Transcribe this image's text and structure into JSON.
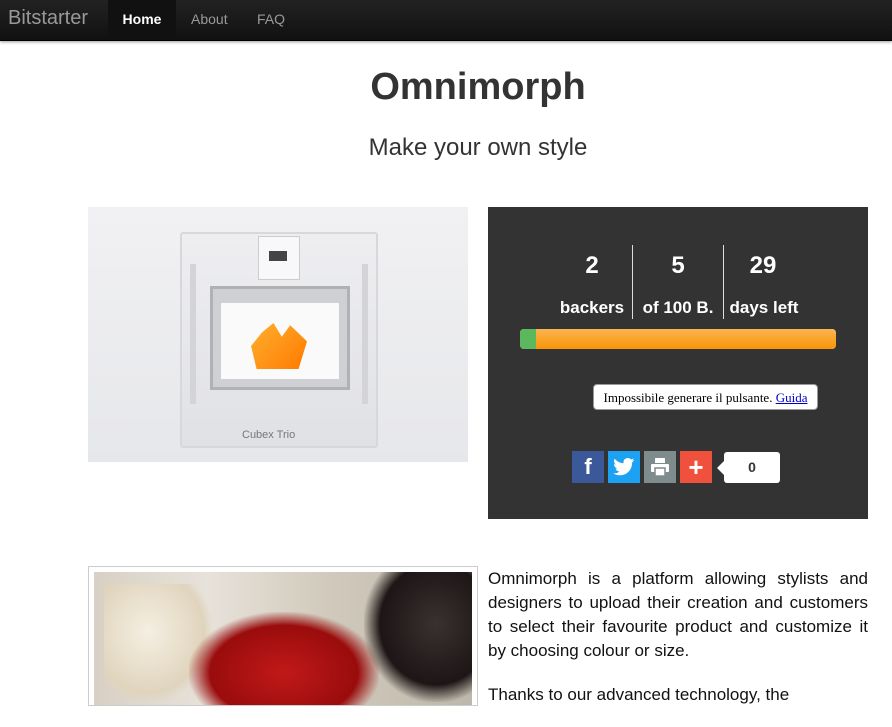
{
  "nav": {
    "brand": "Bitstarter",
    "items": [
      {
        "label": "Home"
      },
      {
        "label": "About"
      },
      {
        "label": "FAQ"
      }
    ]
  },
  "hero": {
    "title": "Omnimorph",
    "subtitle": "Make your own style"
  },
  "printer_image": {
    "label": "Cubex Trio"
  },
  "stats": {
    "backers": {
      "value": "2",
      "label": "backers"
    },
    "funded": {
      "value": "5",
      "label": "of 100 B."
    },
    "days": {
      "value": "29",
      "label": "days left"
    },
    "progress_green_fraction": 0.05,
    "progress_orange_fraction": 0.95
  },
  "widget": {
    "error_text": "Impossibile generare il pulsante.",
    "error_link": "Guida",
    "share_count": "0",
    "buttons": [
      "facebook-icon",
      "twitter-icon",
      "print-icon",
      "plus-icon"
    ]
  },
  "description": {
    "paragraphs": [
      "Omnimorph is a platform allowing stylists and designers to upload their creation and customers to select their favourite product and customize it by choosing colour or size.",
      "Thanks to our advanced technology, the"
    ]
  },
  "colors": {
    "navbar": "#1b1b1b",
    "stats_bg": "#333333",
    "progress_green": "#5cb85c",
    "progress_orange": "#f89406",
    "facebook": "#3b5998",
    "twitter": "#1da1f2",
    "print": "#7f8c8d",
    "plus": "#f0513c"
  }
}
